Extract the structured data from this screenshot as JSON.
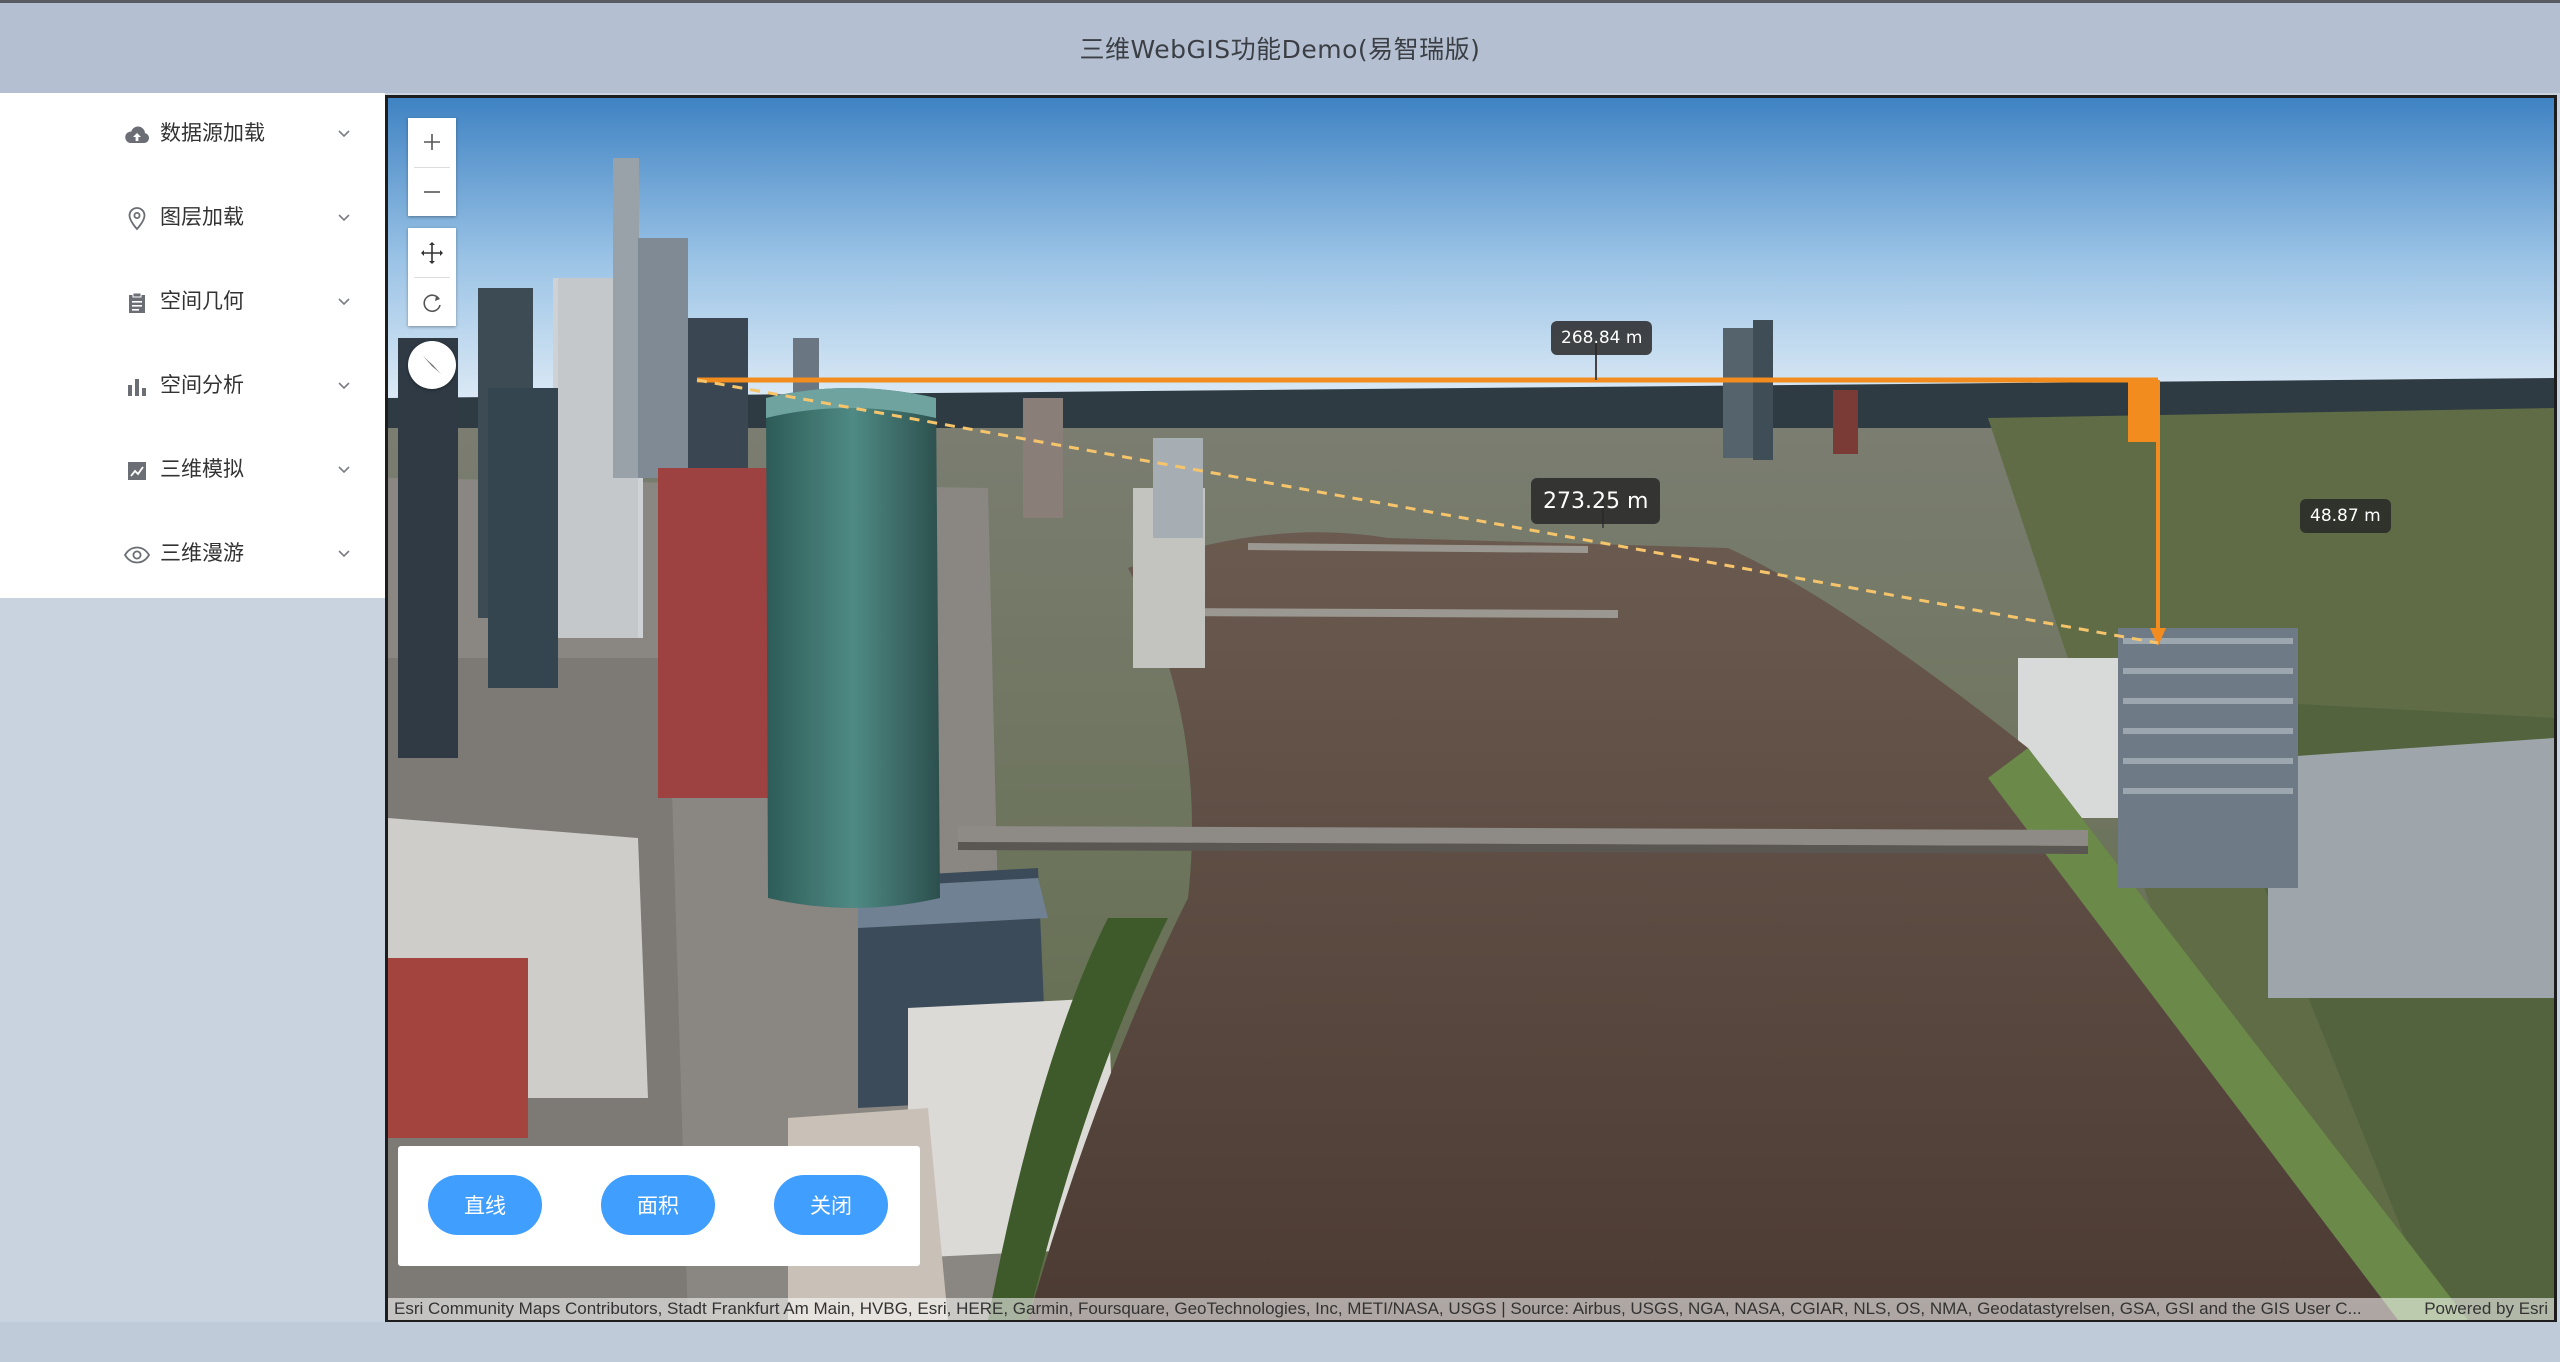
{
  "header": {
    "title": "三维WebGIS功能Demo(易智瑞版)"
  },
  "sidebar": {
    "items": [
      {
        "label": "数据源加载",
        "icon": "cloud-upload-icon"
      },
      {
        "label": "图层加载",
        "icon": "map-pin-icon"
      },
      {
        "label": "空间几何",
        "icon": "clipboard-icon"
      },
      {
        "label": "空间分析",
        "icon": "bar-chart-icon"
      },
      {
        "label": "三维模拟",
        "icon": "line-chart-icon"
      },
      {
        "label": "三维漫游",
        "icon": "eye-icon"
      }
    ]
  },
  "map": {
    "controls": {
      "zoom_in": "+",
      "zoom_out": "−",
      "pan_icon": "pan-arrows-icon",
      "rotate_icon": "rotate-icon",
      "compass_icon": "compass-icon"
    },
    "measurements": {
      "horizontal": "268.84 m",
      "direct": "273.25 m",
      "vertical": "48.87 m"
    },
    "accent_color": "#f28c1e",
    "attribution": {
      "text": "Esri Community Maps Contributors, Stadt Frankfurt Am Main, HVBG, Esri, HERE, Garmin, Foursquare, GeoTechnologies, Inc, METI/NASA, USGS | Source: Airbus, USGS, NGA, NASA, CGIAR, NLS, OS, NMA, Geodatastyrelsen, GSA, GSI and the GIS User C...",
      "powered": "Powered by Esri"
    }
  },
  "tools": {
    "line_label": "直线",
    "area_label": "面积",
    "close_label": "关闭",
    "button_color": "#409eff"
  }
}
